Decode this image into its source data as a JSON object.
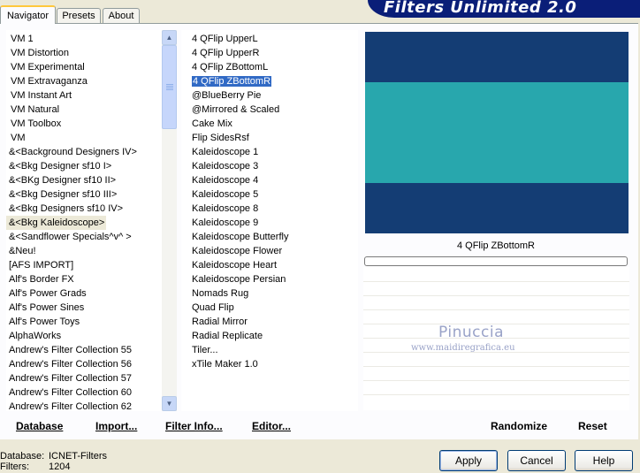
{
  "title": "Filters Unlimited 2.0",
  "tabs": [
    "Navigator",
    "Presets",
    "About"
  ],
  "categories": [
    "VM 1",
    "VM Distortion",
    "VM Experimental",
    "VM Extravaganza",
    "VM Instant Art",
    "VM Natural",
    "VM Toolbox",
    "VM",
    "&<Background Designers IV>",
    "&<Bkg Designer sf10 I>",
    "&<BKg Designer sf10 II>",
    "&<Bkg Designer sf10 III>",
    "&<Bkg Designers sf10 IV>",
    "&<Bkg Kaleidoscope>",
    "&<Sandflower Specials^v^ >",
    "&Neu!",
    "[AFS IMPORT]",
    "Alf's Border FX",
    "Alf's Power Grads",
    "Alf's Power Sines",
    "Alf's Power Toys",
    "AlphaWorks",
    "Andrew's Filter Collection 55",
    "Andrew's Filter Collection 56",
    "Andrew's Filter Collection 57",
    "Andrew's Filter Collection 60",
    "Andrew's Filter Collection 62"
  ],
  "selected_category": "&<Bkg Kaleidoscope>",
  "filters": [
    "4 QFlip UpperL",
    "4 QFlip UpperR",
    "4 QFlip ZBottomL",
    "4 QFlip ZBottomR",
    "@BlueBerry Pie",
    "@Mirrored & Scaled",
    "Cake Mix",
    "Flip SidesRsf",
    "Kaleidoscope 1",
    "Kaleidoscope 3",
    "Kaleidoscope 4",
    "Kaleidoscope 5",
    "Kaleidoscope 8",
    "Kaleidoscope 9",
    "Kaleidoscope Butterfly",
    "Kaleidoscope Flower",
    "Kaleidoscope Heart",
    "Kaleidoscope Persian",
    "Nomads Rug",
    "Quad Flip",
    "Radial Mirror",
    "Radial Replicate",
    "Tiler...",
    "xTile Maker 1.0"
  ],
  "selected_filter": "4 QFlip ZBottomR",
  "preview": {
    "caption": "4 QFlip ZBottomR",
    "bands": [
      {
        "color": "#143d74",
        "fraction": 0.25
      },
      {
        "color": "#28a7ad",
        "fraction": 0.5
      },
      {
        "color": "#143d74",
        "fraction": 0.25
      }
    ]
  },
  "watermark": {
    "name": "Pinuccia",
    "site": "www.maidiregrafica.eu"
  },
  "panel_buttons": {
    "database": "Database",
    "import": "Import...",
    "filter_info": "Filter Info...",
    "editor": "Editor...",
    "randomize": "Randomize",
    "reset": "Reset"
  },
  "status": {
    "database_label": "Database:",
    "database_value": "ICNET-Filters",
    "filters_label": "Filters:",
    "filters_value": "1204"
  },
  "dialog_buttons": {
    "apply": "Apply",
    "cancel": "Cancel",
    "help": "Help"
  },
  "colors": {
    "title_bg": "#0a1e78",
    "selection": "#316ac5"
  }
}
